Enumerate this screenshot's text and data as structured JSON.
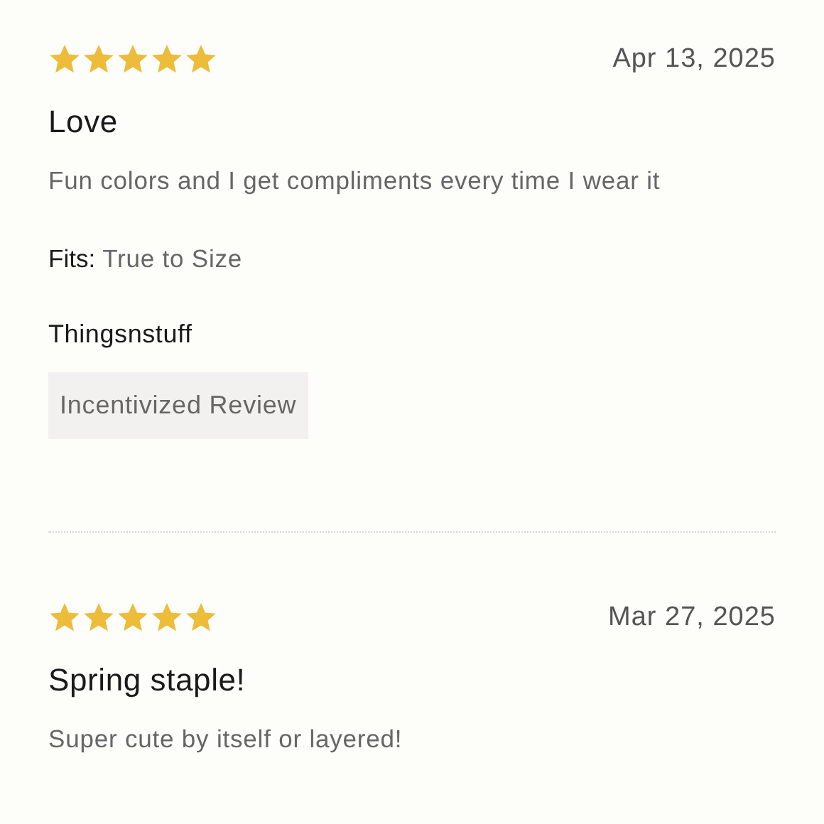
{
  "reviews": [
    {
      "stars": 5,
      "date": "Apr 13, 2025",
      "title": "Love",
      "body": "Fun colors and I get compliments every time I wear it",
      "fit_label": "Fits:",
      "fit_value": "True to Size",
      "author": "Thingsnstuff",
      "badge": "Incentivized Review"
    },
    {
      "stars": 5,
      "date": "Mar 27, 2025",
      "title": "Spring staple!",
      "body": "Super cute by itself or layered!"
    }
  ]
}
